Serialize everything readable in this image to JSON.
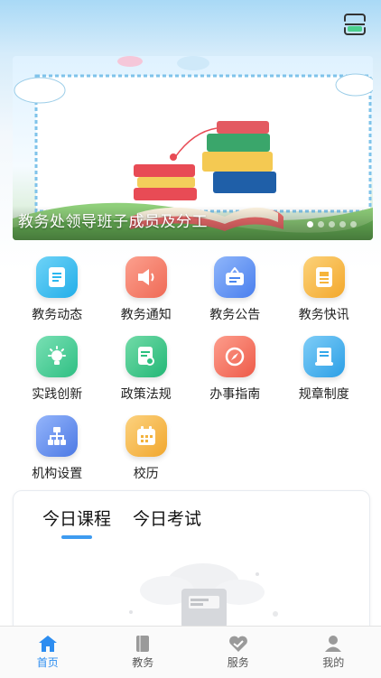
{
  "banner": {
    "title": "教务处领导班子成员及分工",
    "slide_count": 5,
    "active_slide": 1
  },
  "grid": [
    {
      "label": "教务动态",
      "icon": "document-icon",
      "color": "#2bb7ef"
    },
    {
      "label": "教务通知",
      "icon": "speaker-icon",
      "color": "#f1765e"
    },
    {
      "label": "教务公告",
      "icon": "notice-icon",
      "color": "#4a86f0"
    },
    {
      "label": "教务快讯",
      "icon": "newspaper-icon",
      "color": "#f6b43a"
    },
    {
      "label": "实践创新",
      "icon": "lightbulb-icon",
      "color": "#38c78e"
    },
    {
      "label": "政策法规",
      "icon": "regulation-icon",
      "color": "#2cc07f"
    },
    {
      "label": "办事指南",
      "icon": "compass-icon",
      "color": "#f36b57"
    },
    {
      "label": "规章制度",
      "icon": "scroll-icon",
      "color": "#33a7ea"
    },
    {
      "label": "机构设置",
      "icon": "org-chart-icon",
      "color": "#4d7de6"
    },
    {
      "label": "校历",
      "icon": "calendar-icon",
      "color": "#f3b23c"
    }
  ],
  "card": {
    "tabs": [
      "今日课程",
      "今日考试"
    ],
    "active_tab": 0
  },
  "tabbar": {
    "items": [
      {
        "label": "首页",
        "icon": "home-icon"
      },
      {
        "label": "教务",
        "icon": "book-icon"
      },
      {
        "label": "服务",
        "icon": "handshake-icon"
      },
      {
        "label": "我的",
        "icon": "user-icon"
      }
    ],
    "active": 0,
    "active_color": "#2d8df0"
  }
}
